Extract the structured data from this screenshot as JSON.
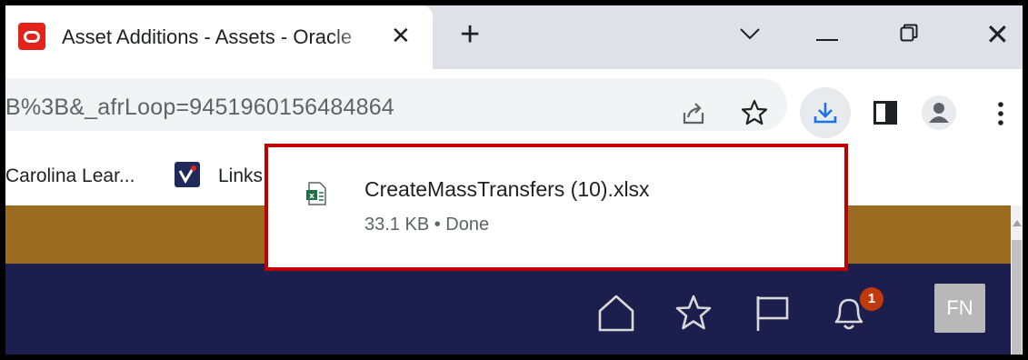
{
  "tab": {
    "title": "Asset Additions - Assets - Oracle",
    "close_label": "✕",
    "new_tab_label": "+"
  },
  "window": {
    "close_label": "✕"
  },
  "address_bar": {
    "url_fragment": "B%3B&_afrLoop=9451960156484864"
  },
  "bookmarks": {
    "items": [
      {
        "label": "Carolina Lear..."
      },
      {
        "label": "Links"
      }
    ]
  },
  "download": {
    "filename": "CreateMassTransfers (10).xlsx",
    "status": "33.1 KB • Done"
  },
  "app_header": {
    "notification_count": "1",
    "user_initials": "FN"
  },
  "colors": {
    "popup_border": "#c00000",
    "gold_band": "#9a6c1f",
    "navy_bar": "#1c1f4d",
    "favicon": "#e2231a",
    "download_icon": "#1a73e8",
    "badge": "#c0390b"
  }
}
